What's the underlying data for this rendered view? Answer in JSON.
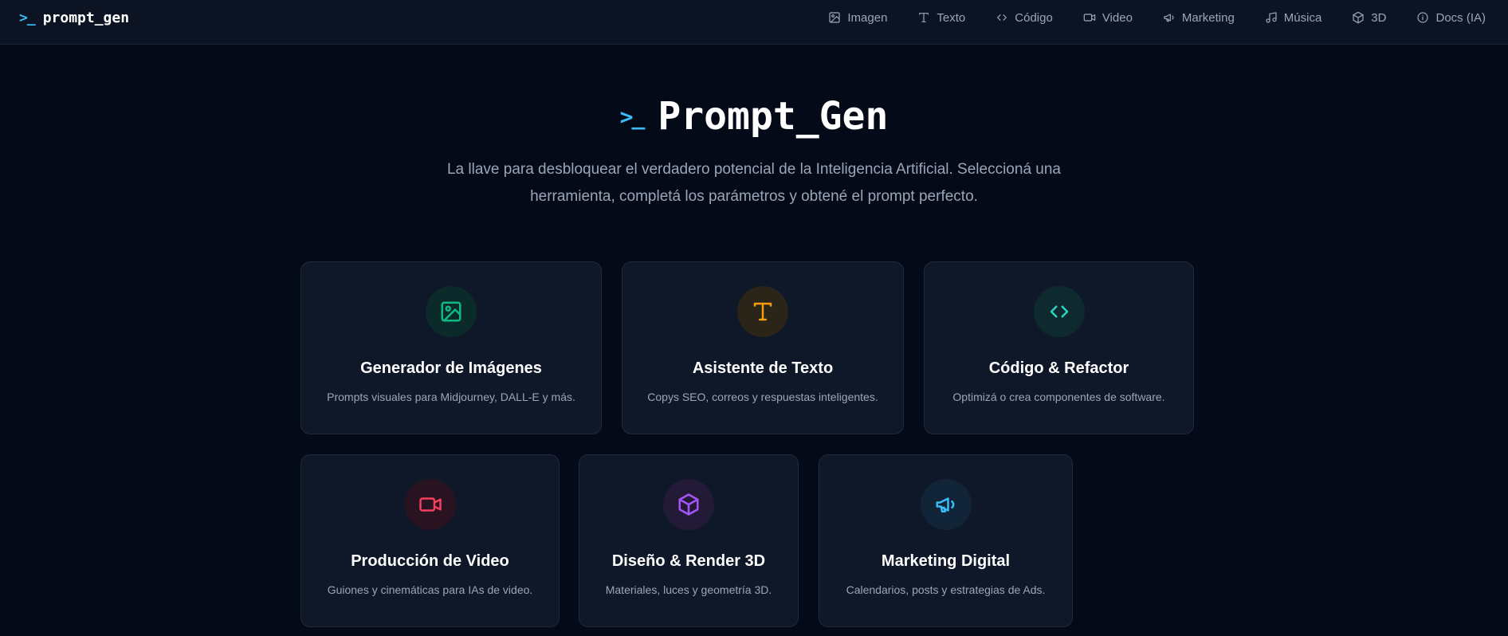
{
  "app": {
    "brand": "prompt_gen",
    "brand_icon": ">_"
  },
  "nav": {
    "items": [
      {
        "label": "Imagen",
        "icon": "image-icon"
      },
      {
        "label": "Texto",
        "icon": "text-icon"
      },
      {
        "label": "Código",
        "icon": "code-icon"
      },
      {
        "label": "Video",
        "icon": "video-icon"
      },
      {
        "label": "Marketing",
        "icon": "megaphone-icon"
      },
      {
        "label": "Música",
        "icon": "music-icon"
      },
      {
        "label": "3D",
        "icon": "cube-icon"
      },
      {
        "label": "Docs (IA)",
        "icon": "info-icon"
      }
    ]
  },
  "hero": {
    "icon": ">_",
    "title": "Prompt_Gen",
    "subtitle": "La llave para desbloquear el verdadero potencial de la Inteligencia Artificial. Seleccioná una herramienta, completá los parámetros y obtené el prompt perfecto."
  },
  "cards": [
    {
      "title": "Generador de Imágenes",
      "description": "Prompts visuales para Midjourney, DALL-E y más.",
      "icon": "image-icon",
      "color": "#10b981"
    },
    {
      "title": "Asistente de Texto",
      "description": "Copys SEO, correos y respuestas inteligentes.",
      "icon": "text-icon",
      "color": "#f59e0b"
    },
    {
      "title": "Código & Refactor",
      "description": "Optimizá o crea componentes de software.",
      "icon": "code-icon",
      "color": "#2dd4bf"
    },
    {
      "title": "Producción de Video",
      "description": "Guiones y cinemáticas para IAs de video.",
      "icon": "video-icon",
      "color": "#f43f5e"
    },
    {
      "title": "Diseño & Render 3D",
      "description": "Materiales, luces y geometría 3D.",
      "icon": "cube-icon",
      "color": "#a855f7"
    },
    {
      "title": "Marketing Digital",
      "description": "Calendarios, posts y estrategias de Ads.",
      "icon": "megaphone-icon",
      "color": "#38bdf8"
    }
  ],
  "colors": {
    "background": "#050a18",
    "topbar": "#0c1424",
    "card": "#0f1829",
    "accent": "#38bdf8",
    "muted_text": "#9aa6b8"
  }
}
